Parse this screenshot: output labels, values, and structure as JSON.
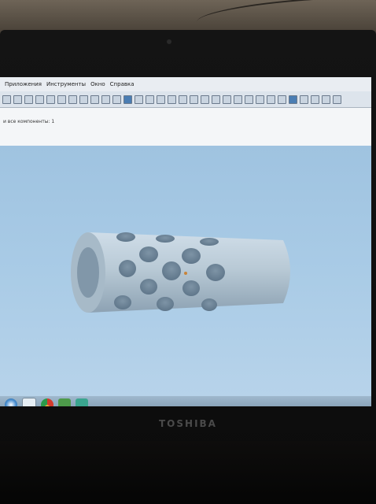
{
  "menu": {
    "items": [
      "Приложения",
      "Инструменты",
      "Окно",
      "Справка"
    ]
  },
  "props_text": "и все компоненты: 1",
  "monitor_brand": "TOSHIBA",
  "colors": {
    "viewport": "#a8c9e4",
    "part": "#b9cad6",
    "bezel": "#111111"
  },
  "taskbar_icons": [
    "windows-start-icon",
    "media-icon",
    "chrome-icon",
    "puzzle-icon",
    "app-icon"
  ]
}
